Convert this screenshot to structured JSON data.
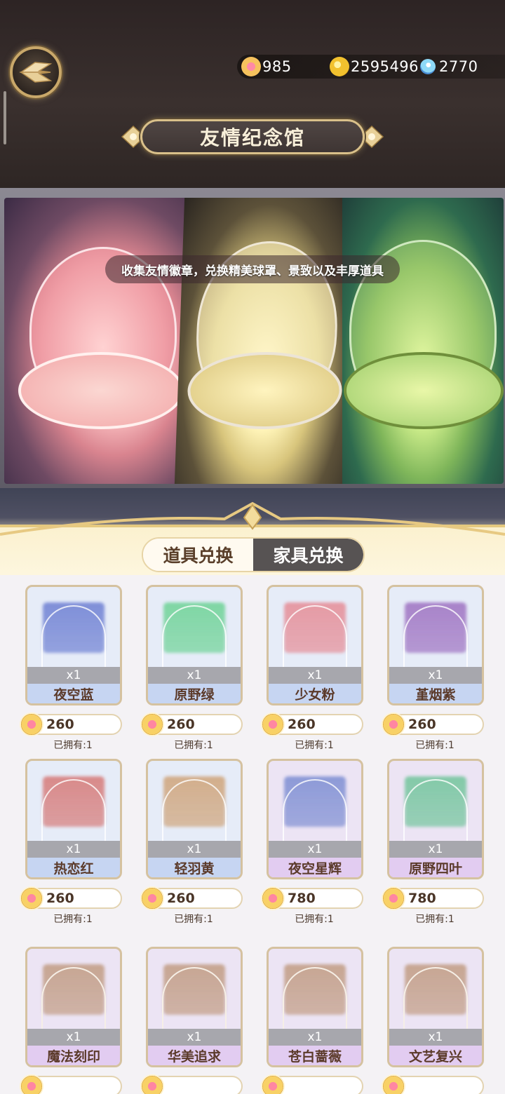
{
  "header": {
    "title": "友情纪念馆",
    "currencies": [
      {
        "icon": "friendship-badge-icon",
        "value": "985"
      },
      {
        "icon": "gold-coin-icon",
        "value": "2595496"
      },
      {
        "icon": "diamond-gem-icon",
        "value": "2770"
      }
    ]
  },
  "banner": {
    "caption": "收集友情徽章，兑换精美球罩、景致以及丰厚道具"
  },
  "tabs": [
    {
      "label": "道具兑换",
      "selected": false
    },
    {
      "label": "家具兑换",
      "selected": true
    }
  ],
  "items": [
    {
      "name": "夜空蓝",
      "qty": "x1",
      "price": "260",
      "owned": "已拥有:1",
      "tone": "#7f8fd8"
    },
    {
      "name": "原野绿",
      "qty": "x1",
      "price": "260",
      "owned": "已拥有:1",
      "tone": "#7fd6a4"
    },
    {
      "name": "少女粉",
      "qty": "x1",
      "price": "260",
      "owned": "已拥有:1",
      "tone": "#e59aa4"
    },
    {
      "name": "堇烟紫",
      "qty": "x1",
      "price": "260",
      "owned": "已拥有:1",
      "tone": "#a883c9"
    },
    {
      "name": "热恋红",
      "qty": "x1",
      "price": "260",
      "owned": "已拥有:1",
      "tone": "#d88a8a"
    },
    {
      "name": "轻羽黄",
      "qty": "x1",
      "price": "260",
      "owned": "已拥有:1",
      "tone": "#d2ae8c"
    },
    {
      "name": "夜空星辉",
      "qty": "x1",
      "price": "780",
      "owned": "已拥有:1",
      "tone": "#8d9ad7"
    },
    {
      "name": "原野四叶",
      "qty": "x1",
      "price": "780",
      "owned": "已拥有:1",
      "tone": "#83c9a8"
    },
    {
      "name": "魔法刻印",
      "qty": "x1",
      "price": "",
      "owned": "",
      "tone": "#c7a693"
    },
    {
      "name": "华美追求",
      "qty": "x1",
      "price": "",
      "owned": "",
      "tone": "#c7a693"
    },
    {
      "name": "苍白蔷薇",
      "qty": "x1",
      "price": "",
      "owned": "",
      "tone": "#c7a693"
    },
    {
      "name": "文艺复兴",
      "qty": "x1",
      "price": "",
      "owned": "",
      "tone": "#c7a693"
    }
  ]
}
